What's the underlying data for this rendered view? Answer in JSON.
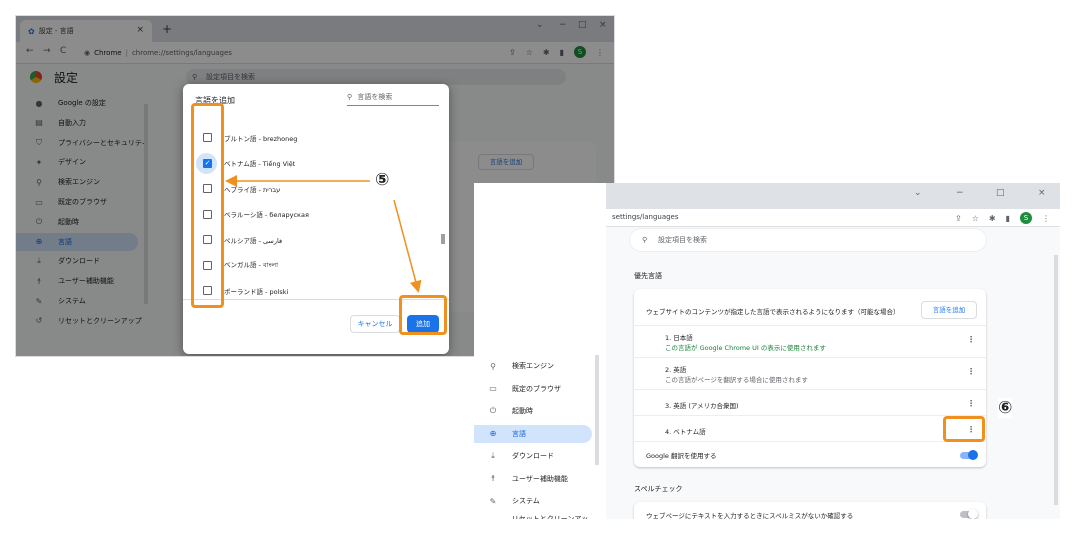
{
  "window1": {
    "tab_title": "設定 - 言語",
    "tab_close": "×",
    "new_tab": "+",
    "window_controls": [
      "⌄",
      "−",
      "□",
      "×"
    ],
    "nav": [
      "←",
      "→",
      "C"
    ],
    "omnibox_site": "Chrome",
    "omnibox_separator": "|",
    "omnibox_path": "chrome://settings/languages",
    "avatar_letter": "S",
    "settings_title": "設定",
    "search_placeholder": "設定項目を検索",
    "sidebar": [
      {
        "label": "Google の設定",
        "icon": "person-icon"
      },
      {
        "label": "自動入力",
        "icon": "clipboard-icon"
      },
      {
        "label": "プライバシーとセキュリティ",
        "icon": "shield-icon"
      },
      {
        "label": "デザイン",
        "icon": "palette-icon"
      },
      {
        "label": "検索エンジン",
        "icon": "search-icon"
      },
      {
        "label": "既定のブラウザ",
        "icon": "browser-icon"
      },
      {
        "label": "起動時",
        "icon": "power-icon"
      },
      {
        "label": "言語",
        "icon": "globe-icon"
      },
      {
        "label": "ダウンロード",
        "icon": "download-icon"
      },
      {
        "label": "ユーザー補助機能",
        "icon": "accessibility-icon"
      },
      {
        "label": "システム",
        "icon": "wrench-icon"
      },
      {
        "label": "リセットとクリーンアップ",
        "icon": "reset-icon"
      }
    ],
    "bg_add_language": "言語を追加",
    "dialog": {
      "title": "言語を追加",
      "search_placeholder": "言語を検索",
      "languages": [
        {
          "label": "ブルトン語 - brezhoneg",
          "checked": false
        },
        {
          "label": "ベトナム語 - Tiếng Việt",
          "checked": true
        },
        {
          "label": "ヘブライ語 - עברית",
          "checked": false
        },
        {
          "label": "ベラルーシ語 - беларуская",
          "checked": false
        },
        {
          "label": "ペルシア語 - فارسی",
          "checked": false
        },
        {
          "label": "ベンガル語 - বাংলা",
          "checked": false
        },
        {
          "label": "ポーランド語 - polski",
          "checked": false
        }
      ],
      "cancel_label": "キャンセル",
      "add_label": "追加"
    }
  },
  "window2": {
    "window_controls": [
      "⌄",
      "−",
      "□",
      "×"
    ],
    "url": "settings/languages",
    "avatar_letter": "S",
    "search_placeholder": "設定項目を検索",
    "section_preferred": "優先言語",
    "card_description": "ウェブサイトのコンテンツが指定した言語で表示されるようになります（可能な場合）",
    "add_language_label": "言語を追加",
    "languages": [
      {
        "name": "1. 日本語",
        "sub": "この言語が Google Chrome UI の表示に使用されます"
      },
      {
        "name": "2. 英語",
        "sub": "この言語がページを翻訳する場合に使用されます"
      },
      {
        "name": "3. 英語 (アメリカ合衆国)",
        "sub": ""
      },
      {
        "name": "4. ベトナム語",
        "sub": ""
      }
    ],
    "translate_label": "Google 翻訳を使用する",
    "section_spellcheck": "スペルチェック",
    "spellcheck_label": "ウェブページにテキストを入力するときにスペルミスがないか確認する",
    "sidebar": [
      {
        "label": "検索エンジン",
        "icon": "search-icon"
      },
      {
        "label": "既定のブラウザ",
        "icon": "browser-icon"
      },
      {
        "label": "起動時",
        "icon": "power-icon"
      },
      {
        "label": "言語",
        "icon": "globe-icon"
      },
      {
        "label": "ダウンロード",
        "icon": "download-icon"
      },
      {
        "label": "ユーザー補助機能",
        "icon": "accessibility-icon"
      },
      {
        "label": "システム",
        "icon": "wrench-icon"
      },
      {
        "label": "リセットとクリーンアップ",
        "icon": "reset-icon"
      }
    ]
  },
  "annotations": {
    "step5": "⑤",
    "step6": "⑥",
    "highlight_color": "#f0901e"
  }
}
